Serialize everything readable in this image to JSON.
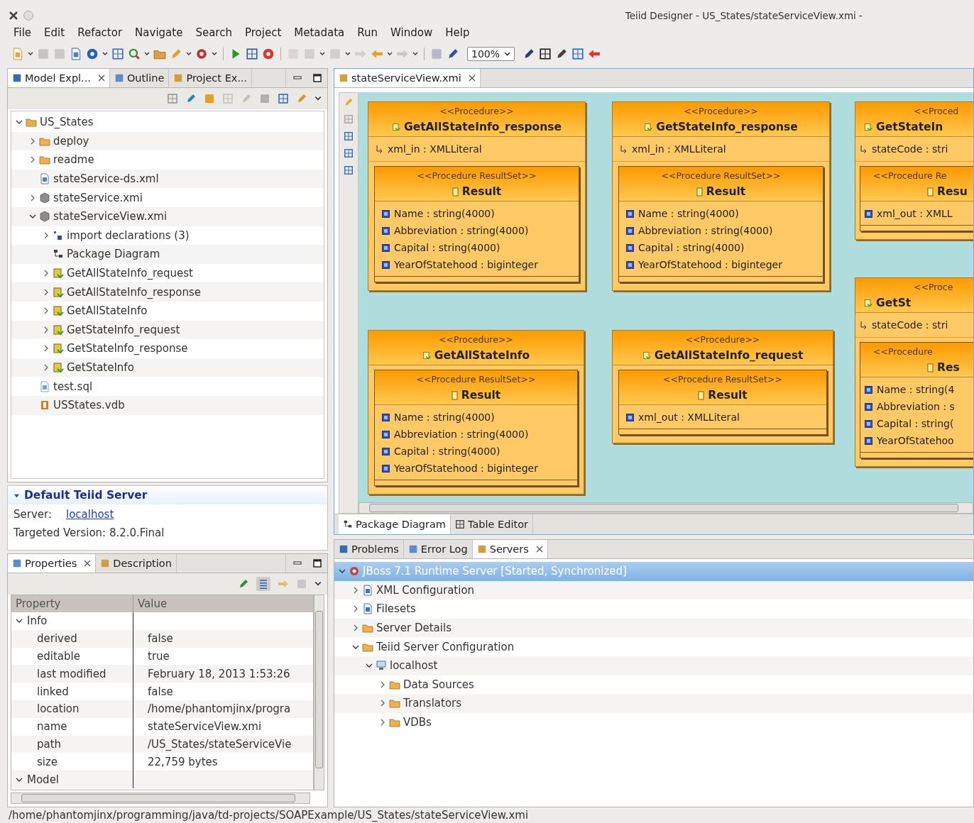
{
  "window": {
    "title": "Teiid Designer - US_States/stateServiceView.xmi -"
  },
  "menu": [
    "File",
    "Edit",
    "Refactor",
    "Navigate",
    "Search",
    "Project",
    "Metadata",
    "Run",
    "Window",
    "Help"
  ],
  "toolbar": {
    "zoom": "100%"
  },
  "explorer": {
    "tabs": [
      {
        "label": "Model Expl...",
        "selected": true
      },
      {
        "label": "Outline",
        "selected": false
      },
      {
        "label": "Project Ex...",
        "selected": false
      }
    ],
    "tree": [
      {
        "label": "US_States",
        "kind": "project",
        "expanded": true,
        "selected": false,
        "children": [
          {
            "label": "deploy",
            "kind": "folder",
            "expanded": false,
            "selected": false
          },
          {
            "label": "readme",
            "kind": "folder",
            "expanded": false,
            "selected": false
          },
          {
            "label": "stateService-ds.xml",
            "kind": "xml-file",
            "selected": false
          },
          {
            "label": "stateService.xmi",
            "kind": "model",
            "expanded": false,
            "selected": false
          },
          {
            "label": "stateServiceView.xmi",
            "kind": "model",
            "expanded": true,
            "selected": false,
            "children": [
              {
                "label": "import declarations (3)",
                "kind": "imports",
                "expanded": false,
                "selected": false
              },
              {
                "label": "Package Diagram",
                "kind": "diagram",
                "selected": false
              },
              {
                "label": "GetAllStateInfo_request",
                "kind": "procedure",
                "expanded": false,
                "selected": false
              },
              {
                "label": "GetAllStateInfo_response",
                "kind": "procedure",
                "expanded": false,
                "selected": false
              },
              {
                "label": "GetAllStateInfo",
                "kind": "procedure",
                "expanded": false,
                "selected": false
              },
              {
                "label": "GetStateInfo_request",
                "kind": "procedure",
                "expanded": false,
                "selected": false
              },
              {
                "label": "GetStateInfo_response",
                "kind": "procedure",
                "expanded": false,
                "selected": false
              },
              {
                "label": "GetStateInfo",
                "kind": "procedure",
                "expanded": false,
                "selected": false
              }
            ]
          },
          {
            "label": "test.sql",
            "kind": "sql-file",
            "selected": false
          },
          {
            "label": "USStates.vdb",
            "kind": "vdb",
            "selected": false
          }
        ]
      }
    ]
  },
  "teiid_server": {
    "title": "Default Teiid Server",
    "expanded": true,
    "server_label": "Server:",
    "server_link": "localhost",
    "version": "Targeted Version: 8.2.0.Final"
  },
  "properties": {
    "tabs": [
      {
        "label": "Properties",
        "selected": true
      },
      {
        "label": "Description",
        "selected": false
      }
    ],
    "columns": [
      "Property",
      "Value"
    ],
    "groups": [
      {
        "label": "Info",
        "expanded": true,
        "rows": [
          {
            "property": "derived",
            "value": "false"
          },
          {
            "property": "editable",
            "value": "true"
          },
          {
            "property": "last modified",
            "value": "February 18, 2013 1:53:26"
          },
          {
            "property": "linked",
            "value": "false"
          },
          {
            "property": "location",
            "value": "/home/phantomjinx/progra"
          },
          {
            "property": "name",
            "value": "stateServiceView.xmi"
          },
          {
            "property": "path",
            "value": "/US_States/stateServiceVie"
          },
          {
            "property": "size",
            "value": "22,759  bytes"
          }
        ]
      },
      {
        "label": "Model",
        "expanded": true
      }
    ]
  },
  "editor": {
    "tabs": [
      {
        "label": "stateServiceView.xmi",
        "selected": true
      }
    ],
    "procedures": [
      {
        "stereotype": "<<Procedure>>",
        "name": "GetAllStateInfo_response",
        "parameters": [
          "xml_in : XMLLiteral"
        ],
        "result_set": {
          "stereotype": "<<Procedure ResultSet>>",
          "name": "Result",
          "columns": [
            "Name : string(4000)",
            "Abbreviation : string(4000)",
            "Capital : string(4000)",
            "YearOfStatehood : biginteger"
          ]
        }
      },
      {
        "stereotype": "<<Procedure>>",
        "name": "GetStateInfo_response",
        "parameters": [
          "xml_in : XMLLiteral"
        ],
        "result_set": {
          "stereotype": "<<Procedure ResultSet>>",
          "name": "Result",
          "columns": [
            "Name : string(4000)",
            "Abbreviation : string(4000)",
            "Capital : string(4000)",
            "YearOfStatehood : biginteger"
          ]
        }
      },
      {
        "stereotype": "<<Proced",
        "name": "GetStateIn",
        "parameters": [
          "stateCode : stri"
        ],
        "result_set": {
          "stereotype": "<<Procedure Re",
          "name": "Resu",
          "columns": [
            "xml_out : XMLL"
          ]
        }
      },
      {
        "stereotype": "<<Procedure>>",
        "name": "GetAllStateInfo",
        "result_set": {
          "stereotype": "<<Procedure ResultSet>>",
          "name": "Result",
          "columns": [
            "Name : string(4000)",
            "Abbreviation : string(4000)",
            "Capital : string(4000)",
            "YearOfStatehood : biginteger"
          ]
        }
      },
      {
        "stereotype": "<<Procedure>>",
        "name": "GetAllStateInfo_request",
        "result_set": {
          "stereotype": "<<Procedure ResultSet>>",
          "name": "Result",
          "columns": [
            "xml_out : XMLLiteral"
          ]
        }
      },
      {
        "stereotype": "<<Proce",
        "name": "GetSt",
        "parameters": [
          "stateCode : stri"
        ],
        "result_set": {
          "stereotype": "<<Procedure",
          "name": "Res",
          "columns": [
            "Name : string(4",
            "Abbreviation : s",
            "Capital : string(",
            "YearOfStatehoo"
          ]
        }
      }
    ],
    "bottom_tabs": [
      {
        "label": "Package Diagram",
        "selected": true
      },
      {
        "label": "Table Editor",
        "selected": false
      }
    ]
  },
  "servers": {
    "tabs": [
      {
        "label": "Problems",
        "selected": false
      },
      {
        "label": "Error Log",
        "selected": false
      },
      {
        "label": "Servers",
        "selected": true
      }
    ],
    "tree": [
      {
        "label": "JBoss 7.1 Runtime Server  [Started, Synchronized]",
        "kind": "server",
        "expanded": true,
        "selected": true,
        "children": [
          {
            "label": "XML Configuration",
            "kind": "config",
            "expanded": false,
            "selected": false
          },
          {
            "label": "Filesets",
            "kind": "fileset",
            "expanded": false,
            "selected": false
          },
          {
            "label": "Server Details",
            "kind": "folder",
            "expanded": false,
            "selected": false
          },
          {
            "label": "Teiid Server Configuration",
            "kind": "folder",
            "expanded": true,
            "selected": false,
            "children": [
              {
                "label": "localhost",
                "kind": "host",
                "expanded": true,
                "selected": false,
                "children": [
                  {
                    "label": "Data Sources",
                    "kind": "folder",
                    "expanded": false,
                    "selected": false
                  },
                  {
                    "label": "Translators",
                    "kind": "folder",
                    "expanded": false,
                    "selected": false
                  },
                  {
                    "label": "VDBs",
                    "kind": "folder",
                    "expanded": false,
                    "selected": false
                  }
                ]
              }
            ]
          }
        ]
      }
    ]
  },
  "status_bar": "/home/phantomjinx/programming/java/td-projects/SOAPExample/US_States/stateServiceView.xmi"
}
